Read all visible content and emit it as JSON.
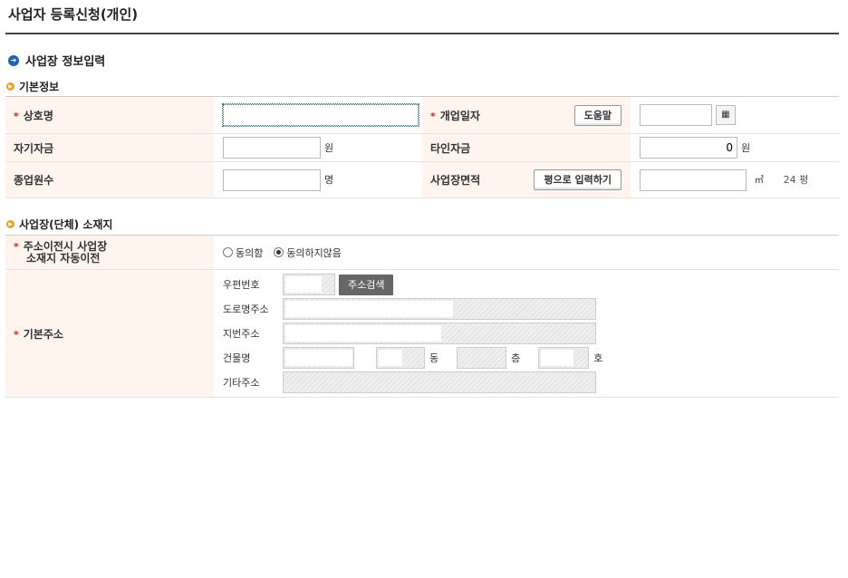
{
  "page_title": "사업자 등록신청(개인)",
  "section_title": "사업장 정보입력",
  "basic_info": {
    "title": "기본정보",
    "trade_name_label": "상호명",
    "trade_name_value": "",
    "open_date_label": "개업일자",
    "help_button": "도움말",
    "open_date_value": "",
    "own_capital_label": "자기자금",
    "own_capital_value": "",
    "won_unit": "원",
    "other_capital_label": "타인자금",
    "other_capital_value": "0",
    "employees_label": "종업원수",
    "employees_value": "",
    "person_unit": "명",
    "area_label": "사업장면적",
    "pyeong_input_button": "평으로 입력하기",
    "area_value": "",
    "sqm_unit": "㎡",
    "pyeong_readout": "24 평"
  },
  "location": {
    "title": "사업장(단체) 소재지",
    "auto_move_label_line1": "주소이전시 사업장",
    "auto_move_label_line2": "소재지 자동이전",
    "agree_option": "동의함",
    "disagree_option": "동의하지않음",
    "selected": "동의하지않음",
    "base_address_label": "기본주소",
    "postal_code_label": "우편번호",
    "address_search_button": "주소검색",
    "road_address_label": "도로명주소",
    "lot_address_label": "지번주소",
    "building_label": "건물명",
    "dong_unit": "동",
    "floor_unit": "층",
    "ho_unit": "호",
    "other_address_label": "기타주소"
  }
}
